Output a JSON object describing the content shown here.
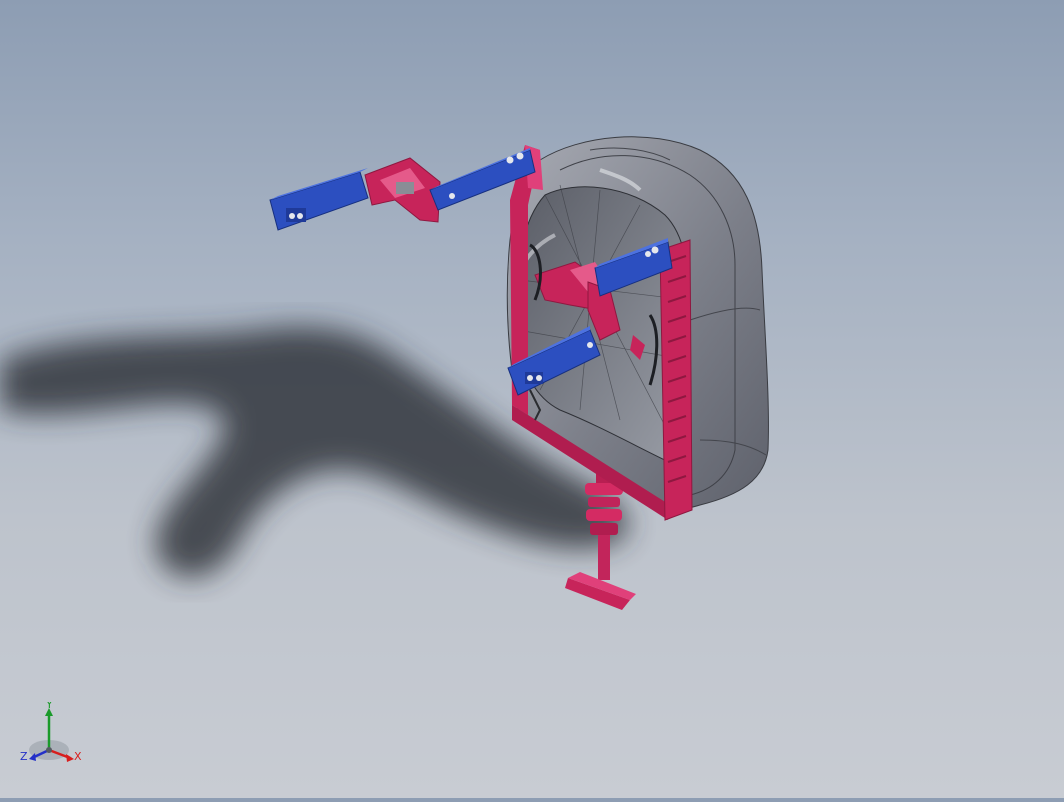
{
  "viewport": {
    "background_top": "#8d9db3",
    "background_bottom": "#c8ccd3"
  },
  "model": {
    "parts": [
      {
        "name": "helmet-shell",
        "color": "#8a8d96"
      },
      {
        "name": "mounting-frame",
        "color": "#c7245a"
      },
      {
        "name": "arm-links",
        "color": "#2c4fc0"
      },
      {
        "name": "pedestal-post",
        "color": "#c7245a"
      }
    ]
  },
  "triad": {
    "x_label": "X",
    "y_label": "Y",
    "z_label": "Z",
    "x_color": "#d81e1e",
    "y_color": "#1a9a2a",
    "z_color": "#2430c8"
  }
}
